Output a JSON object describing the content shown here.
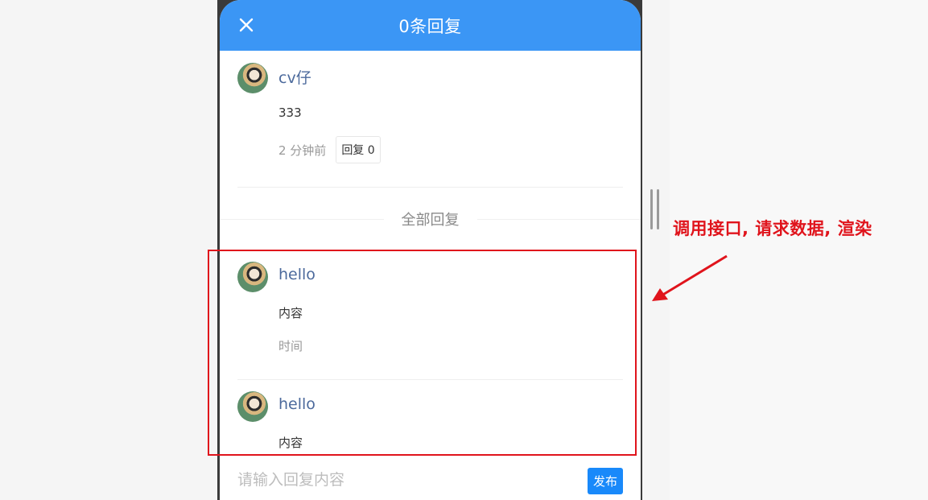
{
  "header": {
    "title": "0条回复"
  },
  "origin_comment": {
    "username": "cv仔",
    "content": "333",
    "time": "2 分钟前",
    "reply_label": "回复 0"
  },
  "section_title": "全部回复",
  "replies": [
    {
      "username": "hello",
      "content": "内容",
      "time": "时间"
    },
    {
      "username": "hello",
      "content": "内容"
    }
  ],
  "footer": {
    "placeholder": "请输入回复内容",
    "publish_label": "发布"
  },
  "annotation": {
    "text": "调用接口, 请求数据, 渲染",
    "color": "#e0141c"
  },
  "colors": {
    "header": "#3b96f5",
    "username": "#4c6a9c",
    "publish": "#1989fa"
  }
}
